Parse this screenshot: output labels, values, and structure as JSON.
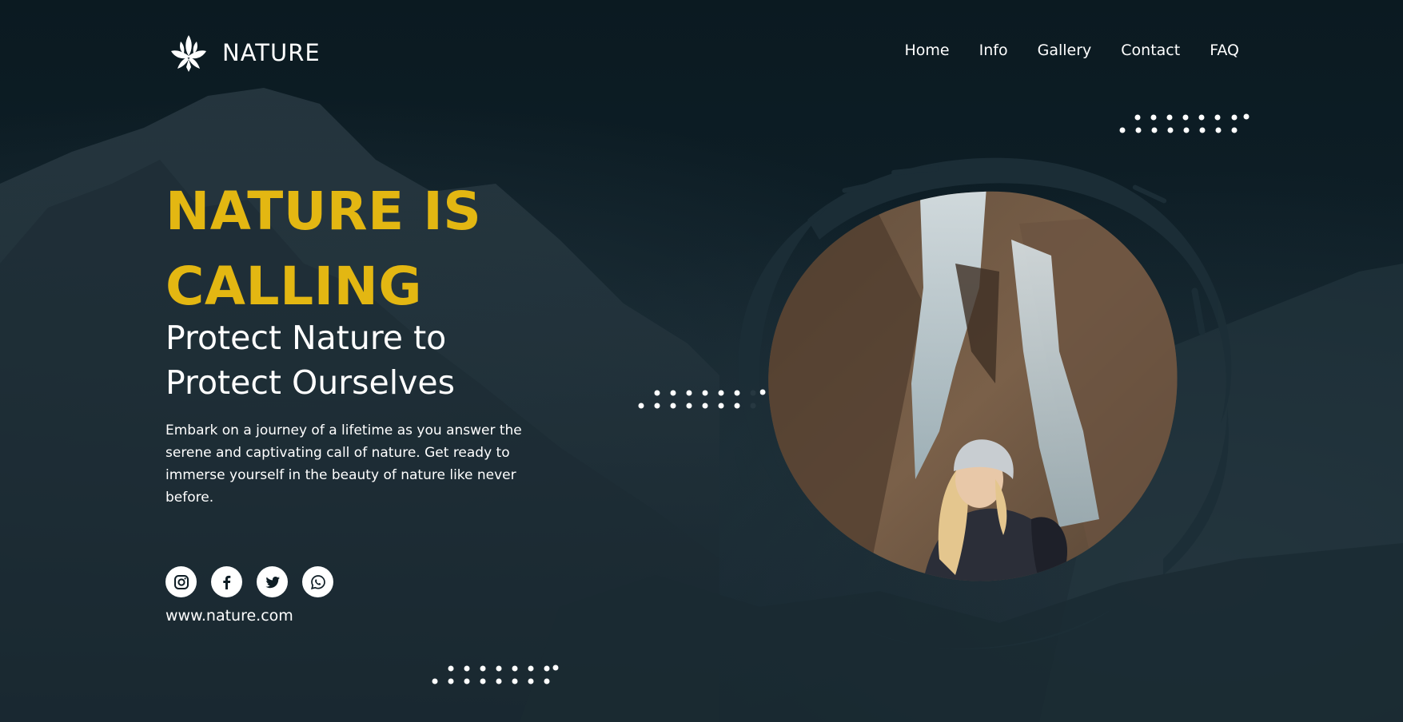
{
  "brand": {
    "name": "NATURE",
    "logo_icon": "lotus-icon"
  },
  "nav": {
    "items": [
      "Home",
      "Info",
      "Gallery",
      "Contact",
      "FAQ"
    ]
  },
  "hero": {
    "headline_line1": "NATURE IS",
    "headline_line2": "CALLING",
    "subhead_line1": "Protect Nature to",
    "subhead_line2": "Protect Ourselves",
    "paragraph": "Embark on a journey of a lifetime as you answer the serene and captivating call of nature. Get ready to immerse yourself in the beauty of nature like never before."
  },
  "socials": [
    {
      "name": "instagram-icon"
    },
    {
      "name": "facebook-icon"
    },
    {
      "name": "twitter-icon"
    },
    {
      "name": "whatsapp-icon"
    }
  ],
  "website": "www.nature.com",
  "colors": {
    "background": "#0d1c24",
    "accent": "#e3b712",
    "text": "#ffffff"
  }
}
